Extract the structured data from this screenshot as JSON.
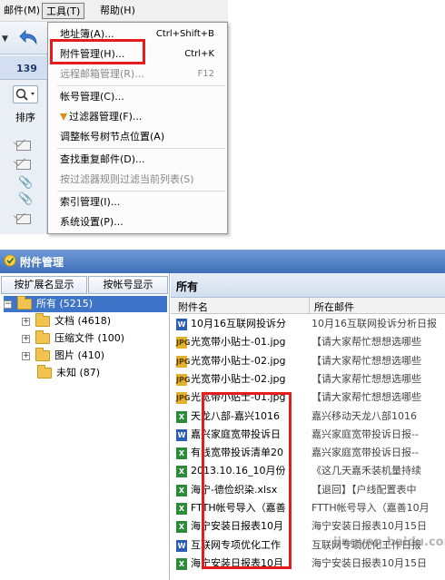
{
  "menubar": {
    "mail_label": "邮件(M)",
    "tools_label": "工具(T)",
    "help_label": "帮助(H)"
  },
  "sidebar": {
    "account_number": "139",
    "sort_label": "排序"
  },
  "tools_menu": {
    "items": [
      {
        "label": "地址簿(A)...",
        "shortcut": "Ctrl+Shift+B",
        "disabled": false
      },
      {
        "label": "附件管理(H)...",
        "shortcut": "Ctrl+K",
        "disabled": false
      },
      {
        "label": "远程邮箱管理(R)...",
        "shortcut": "F12",
        "disabled": true
      },
      {
        "label": "帐号管理(C)...",
        "shortcut": "",
        "disabled": false
      },
      {
        "label": "过滤器管理(F)...",
        "shortcut": "",
        "disabled": false
      },
      {
        "label": "调整帐号树节点位置(A)",
        "shortcut": "",
        "disabled": false
      },
      {
        "label": "查找重复邮件(D)...",
        "shortcut": "",
        "disabled": false
      },
      {
        "label": "按过滤器规则过滤当前列表(S)",
        "shortcut": "",
        "disabled": true
      },
      {
        "label": "索引管理(I)...",
        "shortcut": "",
        "disabled": false
      },
      {
        "label": "系统设置(P)...",
        "shortcut": "",
        "disabled": false
      }
    ]
  },
  "attachment_manager": {
    "title": "附件管理",
    "btn_by_extension": "按扩展名显示",
    "btn_by_account": "按帐号显示",
    "tree": [
      {
        "label": "所有 (5215)",
        "level": 0,
        "expander": "−",
        "selected": true
      },
      {
        "label": "文档 (4618)",
        "level": 1,
        "expander": "+",
        "selected": false
      },
      {
        "label": "压缩文件 (100)",
        "level": 1,
        "expander": "+",
        "selected": false
      },
      {
        "label": "图片 (410)",
        "level": 1,
        "expander": "+",
        "selected": false
      },
      {
        "label": "未知 (87)",
        "level": 1,
        "expander": "",
        "selected": false
      }
    ],
    "right_header": "所有",
    "col_name": "附件名",
    "col_mail": "所在邮件",
    "rows": [
      {
        "type": "doc",
        "icon": "W",
        "name": "10月16互联网投诉分",
        "mail": "10月16互联网投诉分析日报"
      },
      {
        "type": "jpg",
        "icon": "JPG",
        "name": "光宽带小贴士-01.jpg",
        "mail": "【请大家帮忙想想选哪些"
      },
      {
        "type": "jpg",
        "icon": "JPG",
        "name": "光宽带小贴士-02.jpg",
        "mail": "【请大家帮忙想想选哪些"
      },
      {
        "type": "jpg",
        "icon": "JPG",
        "name": "光宽带小贴士-02.jpg",
        "mail": "【请大家帮忙想想选哪些"
      },
      {
        "type": "jpg",
        "icon": "JPG",
        "name": "光宽带小贴士-01.jpg",
        "mail": "【请大家帮忙想想选哪些"
      },
      {
        "type": "xls",
        "icon": "X",
        "name": "天龙八部-嘉兴1016",
        "mail": "嘉兴移动天龙八部1016"
      },
      {
        "type": "doc",
        "icon": "W",
        "name": "嘉兴家庭宽带投诉日",
        "mail": "嘉兴家庭宽带投诉日报--"
      },
      {
        "type": "xls",
        "icon": "X",
        "name": "有线宽带投诉清单20",
        "mail": "嘉兴家庭宽带投诉日报--"
      },
      {
        "type": "xls",
        "icon": "X",
        "name": "2013.10.16_10月份",
        "mail": "《这几天嘉禾装机量持续"
      },
      {
        "type": "xls",
        "icon": "X",
        "name": "海宁-德俭织染.xlsx",
        "mail": "【退回】【户线配置表中"
      },
      {
        "type": "xls",
        "icon": "X",
        "name": "FTTH帐号导入（嘉善",
        "mail": "FTTH帐号导入（嘉善10月"
      },
      {
        "type": "xls",
        "icon": "X",
        "name": "海宁安装日报表10月",
        "mail": "海宁安装日报表10月15日"
      },
      {
        "type": "doc",
        "icon": "W",
        "name": "互联网专项优化工作",
        "mail": "互联网专项优化工作日报"
      },
      {
        "type": "xls",
        "icon": "X",
        "name": "海宁安装日报表10月",
        "mail": "海宁安装日报表10月15日"
      }
    ]
  },
  "watermark": "jingyan.baidu.com",
  "colors": {
    "highlight_box": "#e41c1c",
    "titlebar": "#3e6fb9",
    "selected_tree_row": "#3f75c8"
  }
}
